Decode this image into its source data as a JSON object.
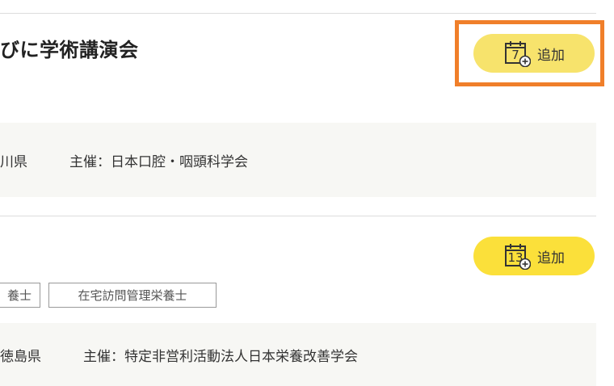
{
  "events": [
    {
      "title": "びに学術講演会",
      "add_button": {
        "label": "追加",
        "calendar_day": "7"
      },
      "prefecture": "川県",
      "organizer": "主催：日本口腔・咽頭科学会"
    },
    {
      "title": "",
      "add_button": {
        "label": "追加",
        "calendar_day": "13"
      },
      "tags": [
        "養士",
        "在宅訪問管理栄養士"
      ],
      "prefecture": "徳島県",
      "organizer": "主催：特定非営利活動法人日本栄養改善学会"
    }
  ],
  "colors": {
    "button_yellow": "#fbe03a",
    "highlight_orange": "#f07f2a",
    "info_background": "#f7f7f4"
  },
  "icons": [
    "calendar-add-icon"
  ]
}
